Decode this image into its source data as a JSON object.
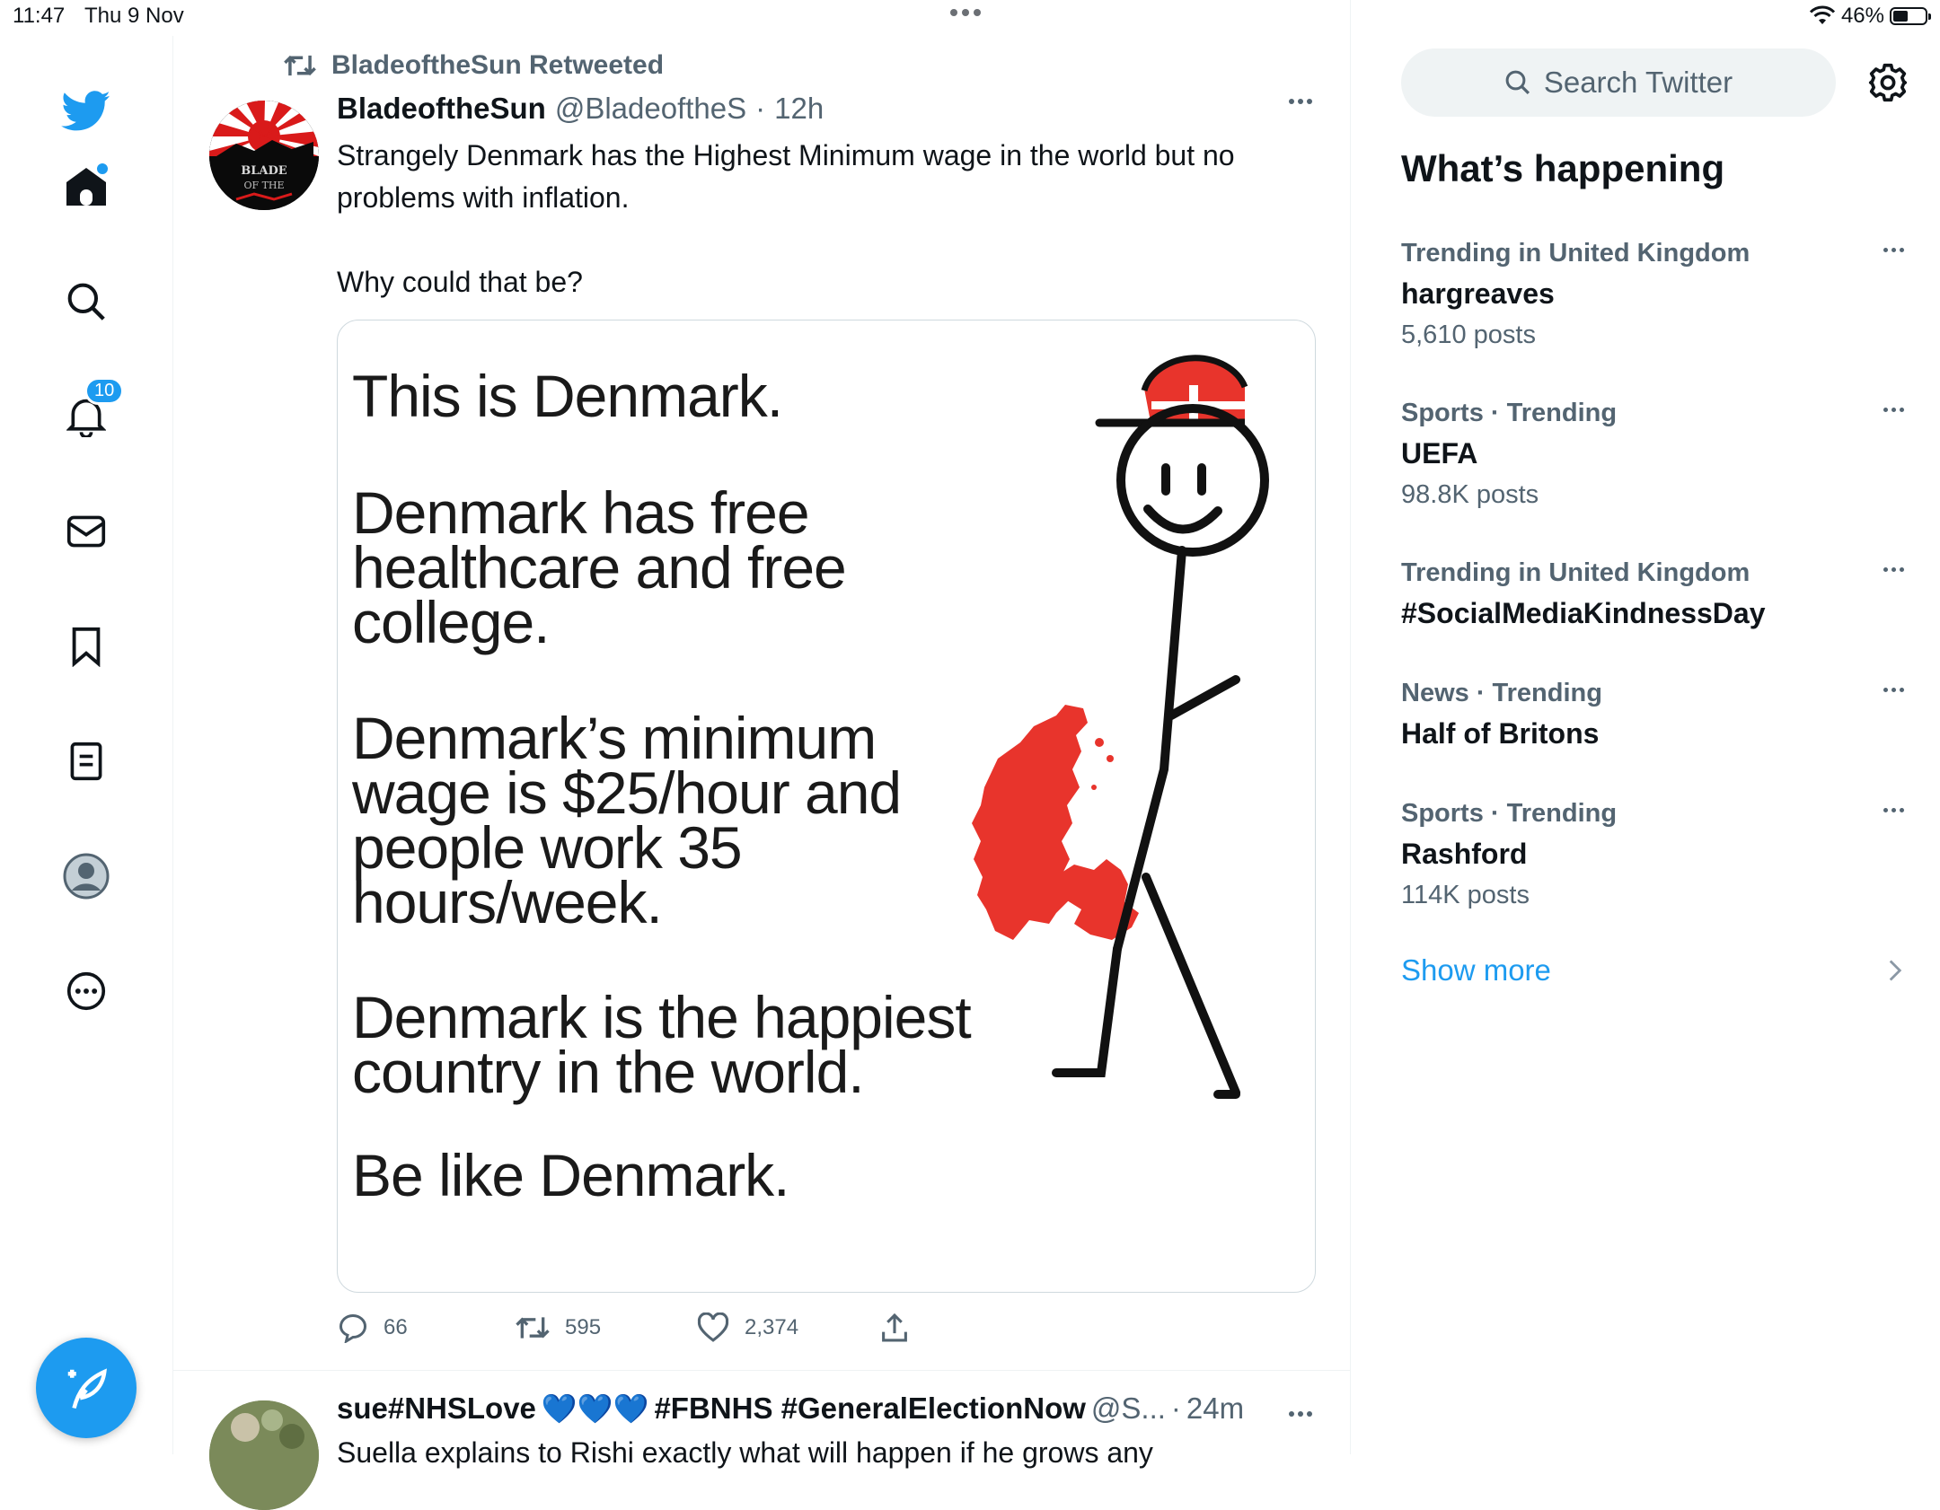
{
  "status_bar": {
    "time": "11:47",
    "date": "Thu 9 Nov",
    "battery": "46%",
    "battery_level": 0.46
  },
  "nav": {
    "notifications_badge": "10",
    "items": [
      "twitter-logo",
      "home",
      "explore",
      "notifications",
      "messages",
      "bookmarks",
      "lists",
      "profile",
      "more"
    ]
  },
  "tweet": {
    "retweet_label": "BladeoftheSun Retweeted",
    "avatar_text": [
      "BLADE",
      "OF THE"
    ],
    "name": "BladeoftheSun",
    "handle": "@BladeoftheS",
    "separator": "·",
    "time": "12h",
    "text_line1": "Strangely Denmark has the Highest Minimum wage in the world but no problems with inflation.",
    "text_line2": "Why could that be?",
    "meme": {
      "line1": "This is Denmark.",
      "line2a": "Denmark has free",
      "line2b": "healthcare and free",
      "line2c": "college.",
      "line3a": "Denmark’s minimum",
      "line3b": "wage is $25/hour and",
      "line3c": "people work 35",
      "line3d": "hours/week.",
      "line4a": "Denmark is the happiest",
      "line4b": "country in the world.",
      "line5": "Be like Denmark."
    },
    "replies": "66",
    "retweets": "595",
    "likes": "2,374"
  },
  "tweet2": {
    "name_part1": "sue#NHSLove",
    "hearts": "💙💙💙",
    "name_part2": "#FBNHS #GeneralElectionNow",
    "handle": "@S...",
    "separator": "·",
    "time": "24m",
    "text": "Suella explains to Rishi exactly what will happen if he grows any"
  },
  "sidebar": {
    "search_placeholder": "Search Twitter",
    "title": "What’s happening",
    "trends": [
      {
        "context": "Trending in United Kingdom",
        "topic": "hargreaves",
        "count": "5,610 posts"
      },
      {
        "context": "Sports · Trending",
        "topic": "UEFA",
        "count": "98.8K posts"
      },
      {
        "context": "Trending in United Kingdom",
        "topic": "#SocialMediaKindnessDay",
        "count": ""
      },
      {
        "context": "News · Trending",
        "topic": "Half of Britons",
        "count": ""
      },
      {
        "context": "Sports · Trending",
        "topic": "Rashford",
        "count": "114K posts"
      }
    ],
    "show_more": "Show more"
  },
  "colors": {
    "accent": "#1d9bf0",
    "secondary_text": "#536471",
    "primary_text": "#0f1419",
    "danish_red": "#e8342c"
  }
}
